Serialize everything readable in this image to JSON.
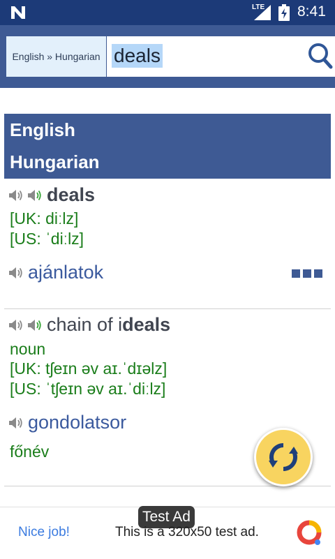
{
  "status_bar": {
    "network": "LTE",
    "time": "8:41",
    "icons": [
      "n-notification-icon",
      "signal-icon",
      "battery-charging-icon"
    ]
  },
  "search": {
    "language_pair": "English » Hungarian",
    "query": "deals",
    "icon": "search-icon"
  },
  "results": {
    "header": {
      "source_language": "English",
      "target_language": "Hungarian"
    },
    "entries": [
      {
        "term_pre": "",
        "term_bold": "deals",
        "term_post": "",
        "pos": "",
        "phonetic_uk": "[UK: diːlz]",
        "phonetic_us": "[US: ˈdiːlz]",
        "translation": "ajánlatok",
        "translation_pos": ""
      },
      {
        "term_pre": "chain of i",
        "term_bold": "deals",
        "term_post": "",
        "pos": "noun",
        "phonetic_uk": "[UK: tʃeɪn əv aɪ.ˈdɪəlz]",
        "phonetic_us": "[US: ˈtʃeɪn əv aɪ.ˈdiːlz]",
        "translation": "gondolatsor",
        "translation_pos": "főnév"
      }
    ]
  },
  "ad": {
    "label": "Test Ad",
    "nice": "Nice job!",
    "text": "This is a 320x50 test ad."
  },
  "colors": {
    "status_bar": "#1c3a78",
    "app_bar": "#3e5a94",
    "phonetic": "#1a7d1a",
    "translation": "#3b5a9e",
    "fab": "#f8d460"
  }
}
